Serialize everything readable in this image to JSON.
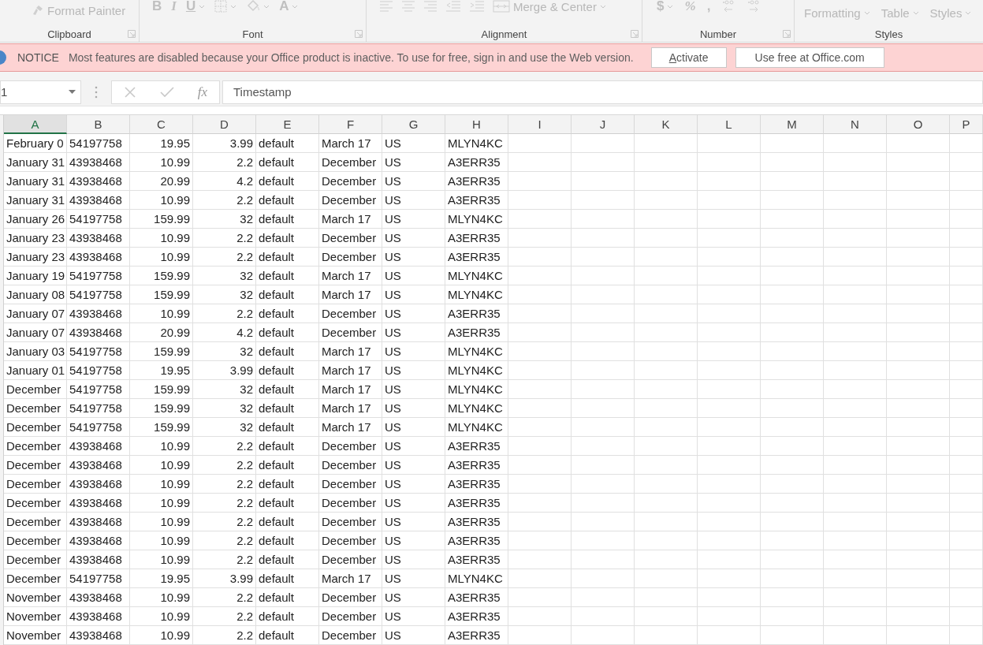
{
  "ribbon": {
    "groups": [
      {
        "label": "Clipboard",
        "launcher": true,
        "controls": [
          {
            "kind": "painter",
            "label": "Format Painter",
            "caret": false
          }
        ]
      },
      {
        "label": "Font",
        "launcher": true,
        "controls": [
          {
            "kind": "glyph",
            "label": "B",
            "caret": false
          },
          {
            "kind": "glyph",
            "label": "I",
            "caret": false
          },
          {
            "kind": "glyph",
            "label": "U",
            "caret": true
          },
          {
            "kind": "borders",
            "caret": true
          },
          {
            "kind": "fill",
            "caret": true
          },
          {
            "kind": "glyph",
            "label": "A",
            "caret": true
          }
        ]
      },
      {
        "label": "Alignment",
        "launcher": true,
        "controls": [
          {
            "kind": "align-left",
            "caret": false
          },
          {
            "kind": "align-center",
            "caret": false
          },
          {
            "kind": "align-right",
            "caret": false
          },
          {
            "kind": "outdent",
            "caret": false
          },
          {
            "kind": "indent",
            "caret": false
          },
          {
            "kind": "merge",
            "label": "Merge & Center",
            "caret": true
          }
        ]
      },
      {
        "label": "Number",
        "launcher": true,
        "controls": [
          {
            "kind": "glyph",
            "label": "$",
            "caret": true
          },
          {
            "kind": "glyph",
            "label": "%",
            "caret": false
          },
          {
            "kind": "glyph",
            "label": ",",
            "caret": false
          },
          {
            "kind": "more-decimal",
            "caret": false
          },
          {
            "kind": "less-decimal",
            "caret": false
          }
        ]
      },
      {
        "label": "Styles",
        "launcher": false,
        "controls": [
          {
            "kind": "text",
            "label": "Formatting",
            "caret": true
          },
          {
            "kind": "text",
            "label": "Table",
            "caret": true
          },
          {
            "kind": "text",
            "label": "Styles",
            "caret": true
          }
        ]
      }
    ]
  },
  "notice": {
    "title": "NOTICE",
    "message": "Most features are disabled because your Office product is inactive. To use for free, sign in and use the Web version.",
    "buttons": [
      {
        "label": "Activate"
      },
      {
        "label": "Use free at Office.com"
      }
    ]
  },
  "formula_bar": {
    "name_box": "1",
    "fx": "fx",
    "value": "Timestamp"
  },
  "columns": [
    {
      "label": "A",
      "selected": true
    },
    {
      "label": "B",
      "selected": false
    },
    {
      "label": "C",
      "selected": false
    },
    {
      "label": "D",
      "selected": false
    },
    {
      "label": "E",
      "selected": false
    },
    {
      "label": "F",
      "selected": false
    },
    {
      "label": "G",
      "selected": false
    },
    {
      "label": "H",
      "selected": false
    },
    {
      "label": "I",
      "selected": false
    },
    {
      "label": "J",
      "selected": false
    },
    {
      "label": "K",
      "selected": false
    },
    {
      "label": "L",
      "selected": false
    },
    {
      "label": "M",
      "selected": false
    },
    {
      "label": "N",
      "selected": false
    },
    {
      "label": "O",
      "selected": false
    },
    {
      "label": "P",
      "selected": false
    }
  ],
  "rows": [
    [
      "February 0",
      "54197758",
      "19.95",
      "3.99",
      "default",
      "March 17",
      "US",
      "MLYN4KC"
    ],
    [
      "January 31",
      "43938468",
      "10.99",
      "2.2",
      "default",
      "December",
      "US",
      "A3ERR35"
    ],
    [
      "January 31",
      "43938468",
      "20.99",
      "4.2",
      "default",
      "December",
      "US",
      "A3ERR35"
    ],
    [
      "January 31",
      "43938468",
      "10.99",
      "2.2",
      "default",
      "December",
      "US",
      "A3ERR35"
    ],
    [
      "January 26",
      "54197758",
      "159.99",
      "32",
      "default",
      "March 17",
      "US",
      "MLYN4KC"
    ],
    [
      "January 23",
      "43938468",
      "10.99",
      "2.2",
      "default",
      "December",
      "US",
      "A3ERR35"
    ],
    [
      "January 23",
      "43938468",
      "10.99",
      "2.2",
      "default",
      "December",
      "US",
      "A3ERR35"
    ],
    [
      "January 19",
      "54197758",
      "159.99",
      "32",
      "default",
      "March 17",
      "US",
      "MLYN4KC"
    ],
    [
      "January 08",
      "54197758",
      "159.99",
      "32",
      "default",
      "March 17",
      "US",
      "MLYN4KC"
    ],
    [
      "January 07",
      "43938468",
      "10.99",
      "2.2",
      "default",
      "December",
      "US",
      "A3ERR35"
    ],
    [
      "January 07",
      "43938468",
      "20.99",
      "4.2",
      "default",
      "December",
      "US",
      "A3ERR35"
    ],
    [
      "January 03",
      "54197758",
      "159.99",
      "32",
      "default",
      "March 17",
      "US",
      "MLYN4KC"
    ],
    [
      "January 01",
      "54197758",
      "19.95",
      "3.99",
      "default",
      "March 17",
      "US",
      "MLYN4KC"
    ],
    [
      "December",
      "54197758",
      "159.99",
      "32",
      "default",
      "March 17",
      "US",
      "MLYN4KC"
    ],
    [
      "December",
      "54197758",
      "159.99",
      "32",
      "default",
      "March 17",
      "US",
      "MLYN4KC"
    ],
    [
      "December",
      "54197758",
      "159.99",
      "32",
      "default",
      "March 17",
      "US",
      "MLYN4KC"
    ],
    [
      "December",
      "43938468",
      "10.99",
      "2.2",
      "default",
      "December",
      "US",
      "A3ERR35"
    ],
    [
      "December",
      "43938468",
      "10.99",
      "2.2",
      "default",
      "December",
      "US",
      "A3ERR35"
    ],
    [
      "December",
      "43938468",
      "10.99",
      "2.2",
      "default",
      "December",
      "US",
      "A3ERR35"
    ],
    [
      "December",
      "43938468",
      "10.99",
      "2.2",
      "default",
      "December",
      "US",
      "A3ERR35"
    ],
    [
      "December",
      "43938468",
      "10.99",
      "2.2",
      "default",
      "December",
      "US",
      "A3ERR35"
    ],
    [
      "December",
      "43938468",
      "10.99",
      "2.2",
      "default",
      "December",
      "US",
      "A3ERR35"
    ],
    [
      "December",
      "43938468",
      "10.99",
      "2.2",
      "default",
      "December",
      "US",
      "A3ERR35"
    ],
    [
      "December",
      "54197758",
      "19.95",
      "3.99",
      "default",
      "March 17",
      "US",
      "MLYN4KC"
    ],
    [
      "November",
      "43938468",
      "10.99",
      "2.2",
      "default",
      "December",
      "US",
      "A3ERR35"
    ],
    [
      "November",
      "43938468",
      "10.99",
      "2.2",
      "default",
      "December",
      "US",
      "A3ERR35"
    ],
    [
      "November",
      "43938468",
      "10.99",
      "2.2",
      "default",
      "December",
      "US",
      "A3ERR35"
    ]
  ]
}
